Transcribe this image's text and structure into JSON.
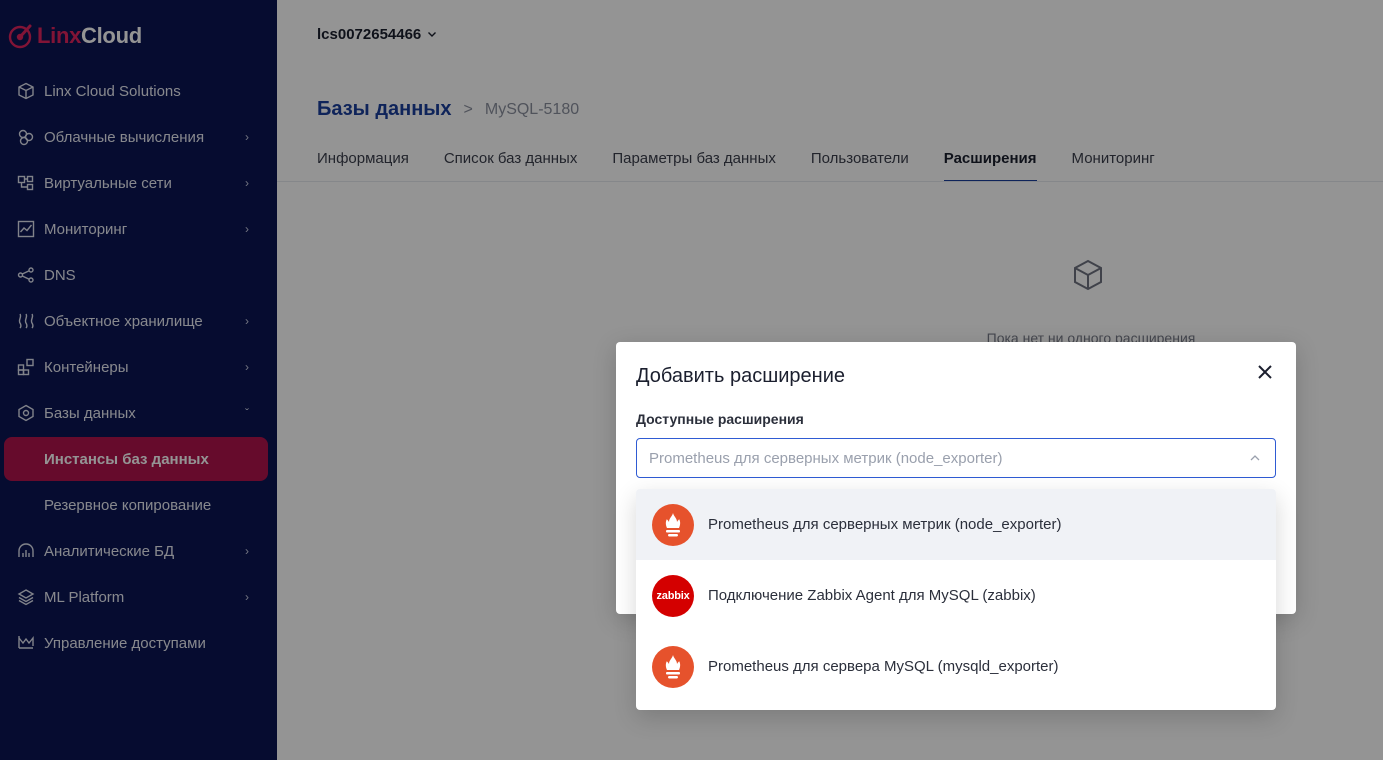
{
  "brand": {
    "part1": "Linx",
    "part2": "Cloud",
    "accent": "#e0245e",
    "sidebar_bg": "#0b1654"
  },
  "sidebar": {
    "items": [
      {
        "label": "Linx Cloud Solutions",
        "icon": "cube-icon",
        "chevron": false
      },
      {
        "label": "Облачные вычисления",
        "icon": "cloud-compute-icon",
        "chevron": true
      },
      {
        "label": "Виртуальные сети",
        "icon": "network-icon",
        "chevron": true
      },
      {
        "label": "Мониторинг",
        "icon": "chart-icon",
        "chevron": true
      },
      {
        "label": "DNS",
        "icon": "share-icon",
        "chevron": false
      },
      {
        "label": "Объектное хранилище",
        "icon": "storage-icon",
        "chevron": true
      },
      {
        "label": "Контейнеры",
        "icon": "containers-icon",
        "chevron": true
      },
      {
        "label": "Базы данных",
        "icon": "database-icon",
        "chevron": true,
        "expanded": true
      }
    ],
    "sub_items": [
      {
        "label": "Инстансы баз данных",
        "active": true
      },
      {
        "label": "Резервное копирование",
        "active": false
      }
    ],
    "items_after": [
      {
        "label": "Аналитические БД",
        "icon": "analytics-icon",
        "chevron": true
      },
      {
        "label": "ML Platform",
        "icon": "layers-icon",
        "chevron": true
      },
      {
        "label": "Управление доступами",
        "icon": "access-icon",
        "chevron": false
      }
    ],
    "active_color": "#b0144d"
  },
  "header": {
    "account": "lcs0072654466"
  },
  "breadcrumb": {
    "root": "Базы данных",
    "separator": ">",
    "current": "MySQL-5180"
  },
  "tabs": [
    {
      "label": "Информация",
      "active": false
    },
    {
      "label": "Список баз данных",
      "active": false
    },
    {
      "label": "Параметры баз данных",
      "active": false
    },
    {
      "label": "Пользователи",
      "active": false
    },
    {
      "label": "Расширения",
      "active": true
    },
    {
      "label": "Мониторинг",
      "active": false
    }
  ],
  "empty_state": {
    "text": "Пока нет ни одного расширения"
  },
  "modal": {
    "title": "Добавить расширение",
    "field_label": "Доступные расширения",
    "select_placeholder": "Prometheus для серверных метрик (node_exporter)"
  },
  "dropdown": {
    "options": [
      {
        "label": "Prometheus для серверных метрик (node_exporter)",
        "icon": "prometheus-icon",
        "highlighted": true
      },
      {
        "label": "Подключение Zabbix Agent для MySQL (zabbix)",
        "icon": "zabbix-icon",
        "badge_text": "zabbix",
        "highlighted": false
      },
      {
        "label": "Prometheus для сервера MySQL (mysqld_exporter)",
        "icon": "prometheus-icon",
        "highlighted": false
      }
    ]
  }
}
